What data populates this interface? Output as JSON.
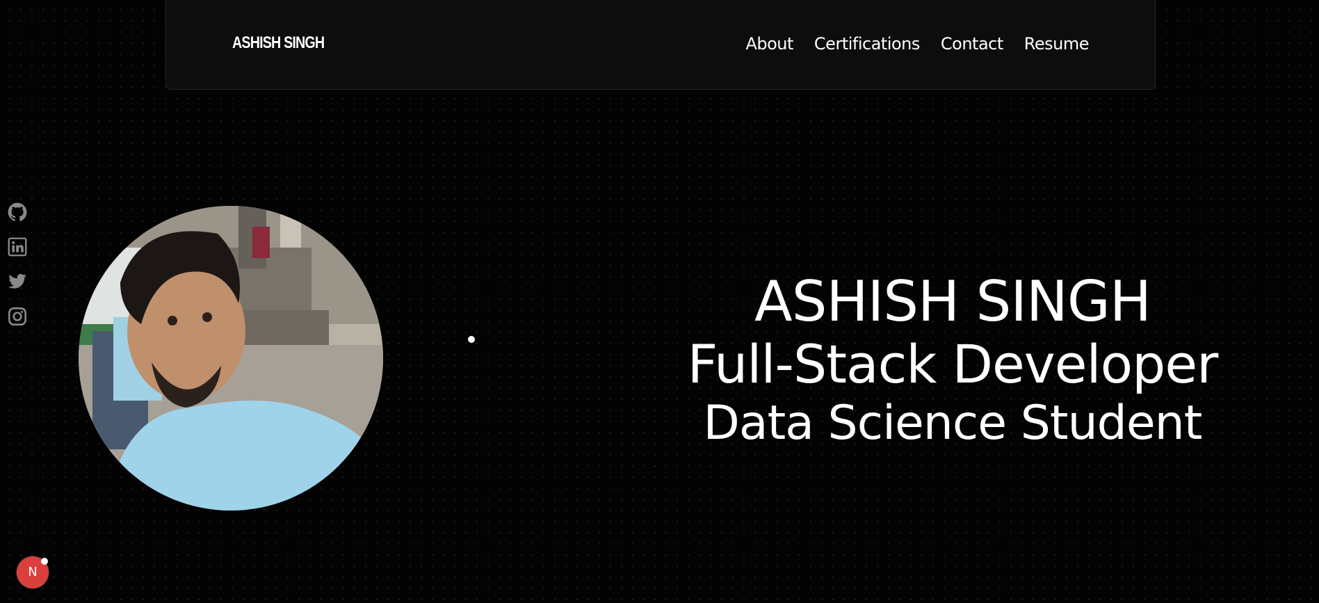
{
  "navbar": {
    "brand": "ASHISH SINGH",
    "links": [
      "About",
      "Certifications",
      "Contact",
      "Resume"
    ]
  },
  "social": {
    "icons": [
      "github-icon",
      "linkedin-icon",
      "twitter-icon",
      "instagram-icon"
    ],
    "color": "#8a8a8a"
  },
  "hero": {
    "name": "ASHISH SINGH",
    "role": "Full-Stack Developer",
    "study": "Data Science Student"
  },
  "dev_indicator": {
    "label": "N",
    "color": "#d9403c"
  },
  "colors": {
    "background": "#030303",
    "navbar": "#0d0d0d",
    "text": "#ffffff"
  }
}
